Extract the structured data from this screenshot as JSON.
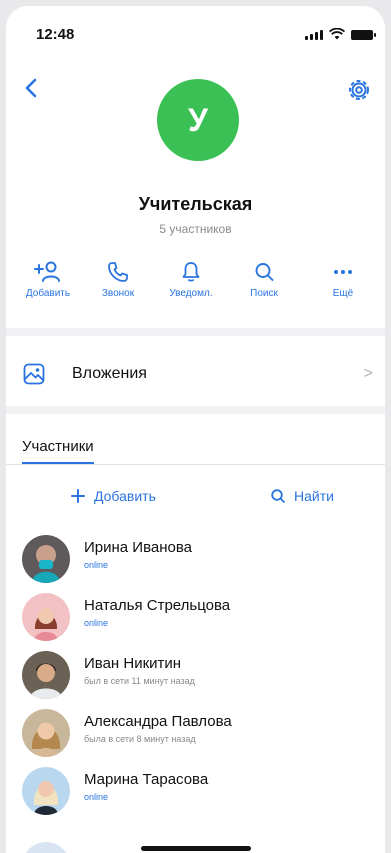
{
  "status": {
    "time": "12:48"
  },
  "group": {
    "initial": "У",
    "name": "Учительская",
    "count": "5 участников"
  },
  "actions": [
    {
      "label": "Добавить",
      "icon": "add-user-icon"
    },
    {
      "label": "Звонок",
      "icon": "phone-icon"
    },
    {
      "label": "Уведомл.",
      "icon": "bell-icon"
    },
    {
      "label": "Поиск",
      "icon": "search-icon"
    },
    {
      "label": "Ещё",
      "icon": "more-icon"
    }
  ],
  "attachments": {
    "label": "Вложения",
    "chevron": ">"
  },
  "members_section": {
    "tab_label": "Участники",
    "add_label": "Добавить",
    "find_label": "Найти"
  },
  "members": [
    {
      "name": "Ирина Иванова",
      "status": "online",
      "online": true
    },
    {
      "name": "Наталья Стрельцова",
      "status": "online",
      "online": true
    },
    {
      "name": "Иван Никитин",
      "status": "был в сети 11 минут назад",
      "online": false
    },
    {
      "name": "Александра Павлова",
      "status": "была в сети 8 минут назад",
      "online": false
    },
    {
      "name": "Марина Тарасова",
      "status": "online",
      "online": true
    }
  ],
  "colors": {
    "accent": "#2a74e0",
    "avatar_green": "#3bc055",
    "muted": "#8a8a8f"
  }
}
